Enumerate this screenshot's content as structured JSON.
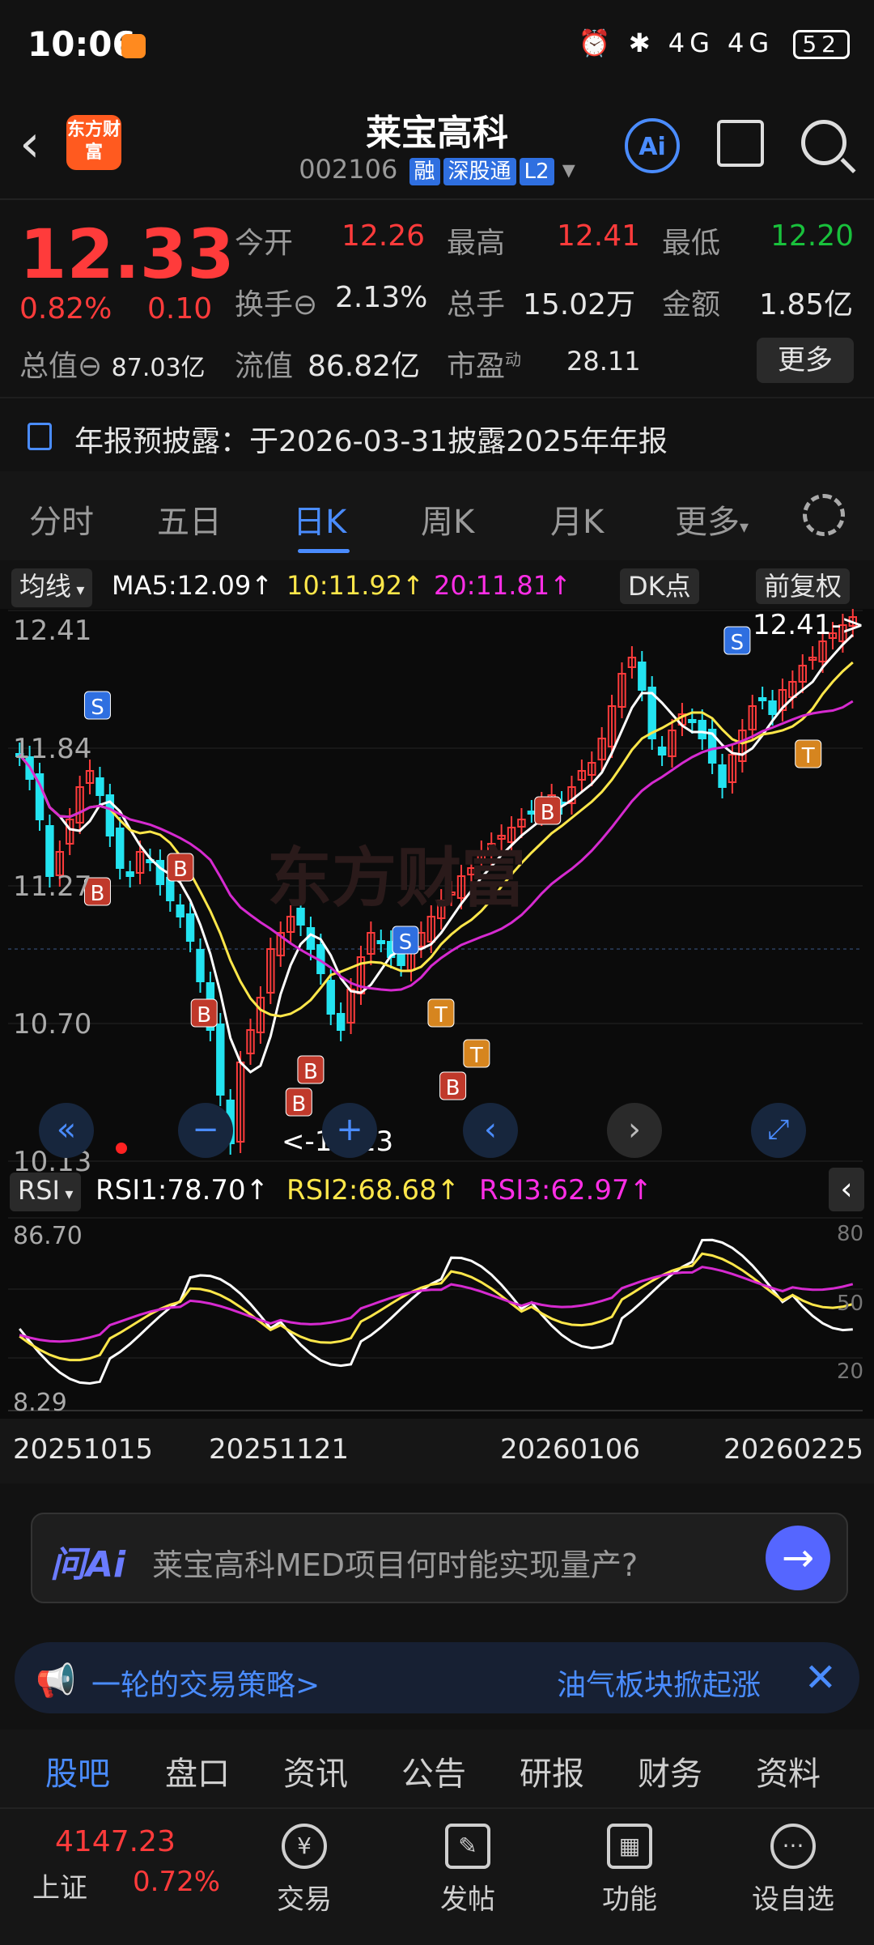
{
  "status_bar": {
    "time": "10:06",
    "signal_text": "⏰ ✱ 4G 4G",
    "battery": "52"
  },
  "header": {
    "back_icon": "back-arrow-icon",
    "logo_text": "东方财富",
    "stock_name": "莱宝高科",
    "stock_code": "002106",
    "tags": [
      "融",
      "深股通",
      "L2"
    ],
    "ai_label": "Ai"
  },
  "quote": {
    "price": "12.33",
    "change_pct": "0.82%",
    "change_amt": "0.10",
    "total_cap_label": "总值",
    "total_cap": "87.03亿",
    "open_label": "今开",
    "open": "12.26",
    "high_label": "最高",
    "high": "12.41",
    "low_label": "最低",
    "low": "12.20",
    "turnover_label": "换手",
    "turnover": "2.13%",
    "volume_label": "总手",
    "volume": "15.02万",
    "amount_label": "金额",
    "amount": "1.85亿",
    "float_cap_label": "流值",
    "float_cap": "86.82亿",
    "pe_label": "市盈",
    "pe_sup": "动",
    "pe": "28.11",
    "more_label": "更多",
    "colors": {
      "up": "#ff3b3b",
      "down": "#19c13c"
    }
  },
  "notice": {
    "text": "年报预披露：于2026-03-31披露2025年年报"
  },
  "chart_tabs": {
    "items": [
      "分时",
      "五日",
      "日K",
      "周K",
      "月K",
      "更多"
    ],
    "active": "日K",
    "accent": "#4a8cff"
  },
  "kline": {
    "indicator_label": "均线",
    "ma5": "MA5:12.09",
    "ma10": "10:11.92",
    "ma20": "20:11.81",
    "dk_label": "DK点",
    "adjust_label": "前复权",
    "price_labels": [
      "12.41",
      "11.84",
      "11.27",
      "10.70",
      "10.13"
    ],
    "high_marker": "12.41->",
    "low_marker": "<-10.13",
    "watermark": "东方财富"
  },
  "rsi": {
    "label": "RSI",
    "rsi1": "RSI1:78.70",
    "rsi2": "RSI2:68.68",
    "rsi3": "RSI3:62.97",
    "axis_top": "86.70",
    "axis_bottom": "8.29",
    "axis_right": [
      "80",
      "50",
      "20"
    ]
  },
  "dates": [
    "20251015",
    "20251121",
    "20260106",
    "20260225"
  ],
  "ask_ai": {
    "logo": "问Ai",
    "placeholder": "莱宝高科MED项目何时能实现量产?"
  },
  "ticker": {
    "left_text": "一轮的交易策略>",
    "right_text": "油气板块掀起涨"
  },
  "bottom_tabs": {
    "items": [
      "股吧",
      "盘口",
      "资讯",
      "公告",
      "研报",
      "财务",
      "资料"
    ],
    "active": "股吧"
  },
  "bottom_bar": {
    "index_value": "4147.23",
    "index_name": "上证",
    "index_pct": "0.72%",
    "buttons": [
      "交易",
      "发帖",
      "功能",
      "设自选"
    ]
  }
}
